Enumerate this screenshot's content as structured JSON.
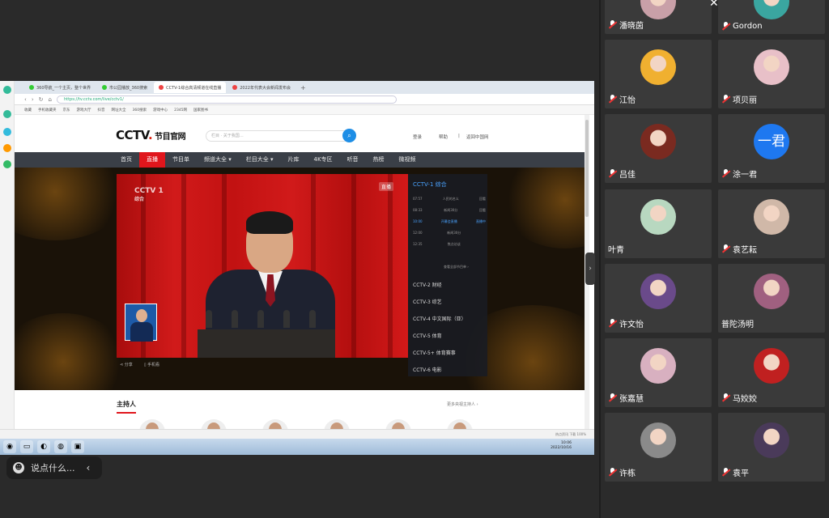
{
  "browser": {
    "tabs": [
      "360导航_一个主页，整个世界",
      "市公园播放_360搜索",
      "CCTV-1综合高清频道在线直播",
      "2022年代表大会新闻发布会"
    ],
    "active_tab": 2,
    "url": "https://tv.cctv.com/live/cctv1/",
    "bookmarks": [
      "收藏",
      "手机收藏夹",
      "京东",
      "游戏大厅",
      "抖音",
      "网址大全",
      "360搜索",
      "游戏中心",
      "2345网",
      "国家图书"
    ]
  },
  "site": {
    "logo_main": "CCTV",
    "logo_dot": ".",
    "logo_sub": "节目官网",
    "search_placeholder": "栏目 · 关于我国…",
    "header_links": [
      "登录",
      "帮助",
      "|",
      "返回中国网"
    ],
    "nav": [
      "首页",
      "直播",
      "节目单",
      "频道大全 ▾",
      "栏目大全 ▾",
      "片库",
      "4K专区",
      "听音",
      "热榜",
      "微视频"
    ],
    "live_index": 1
  },
  "player": {
    "video_logo": "CCTV 1",
    "video_logo_sub": "综合",
    "live_tag": "直播",
    "controls": [
      "分享",
      "手机看"
    ],
    "panel_title": "CCTV-1 综合",
    "programs": [
      {
        "t": "07:57",
        "n": "人民的名义",
        "s": "回看"
      },
      {
        "t": "08:33",
        "n": "新闻30分",
        "s": "回看"
      },
      {
        "t": "10:00",
        "n": "开幕会直播",
        "s": "直播中"
      },
      {
        "t": "12:00",
        "n": "新闻30分",
        "s": ""
      },
      {
        "t": "12:35",
        "n": "焦点访谈",
        "s": ""
      }
    ],
    "more_programs": "查看全部节目单 ›",
    "channels": [
      "CCTV-2 财经",
      "CCTV-3 综艺",
      "CCTV-4 中文国际（亚）",
      "CCTV-5 体育",
      "CCTV-5+ 体育赛事",
      "CCTV-6 电影"
    ]
  },
  "hosts": {
    "title": "主持人",
    "more": "更多央视主持人 ›"
  },
  "statusbar": "热点资讯  下载  100%",
  "taskbar_clock": {
    "time": "10:06",
    "date": "2022/10/16"
  },
  "chat": {
    "placeholder": "说点什么...",
    "chevron": "‹"
  },
  "participants": [
    {
      "name": "潘晓茵",
      "avatar": "photo"
    },
    {
      "name": "Gordon",
      "avatar": "photo"
    },
    {
      "name": "江怡",
      "avatar": "photo"
    },
    {
      "name": "项贝丽",
      "avatar": "photo"
    },
    {
      "name": "吕佳",
      "avatar": "photo"
    },
    {
      "name": "涂一君",
      "avatar": "text",
      "avatar_text": "一君"
    },
    {
      "name": "叶青",
      "avatar": "photo",
      "muted": false
    },
    {
      "name": "袁艺耘",
      "avatar": "photo"
    },
    {
      "name": "许文怡",
      "avatar": "photo"
    },
    {
      "name": "普陀汤明",
      "avatar": "photo",
      "muted": false
    },
    {
      "name": "张嘉慧",
      "avatar": "photo"
    },
    {
      "name": "马姣姣",
      "avatar": "photo"
    },
    {
      "name": "许栋",
      "avatar": "photo"
    },
    {
      "name": "袁平",
      "avatar": "photo"
    }
  ],
  "colors": {
    "cctv_red": "#e0161c",
    "nav_dark": "#3a3f47",
    "avatar_blue": "#1e78f0"
  }
}
